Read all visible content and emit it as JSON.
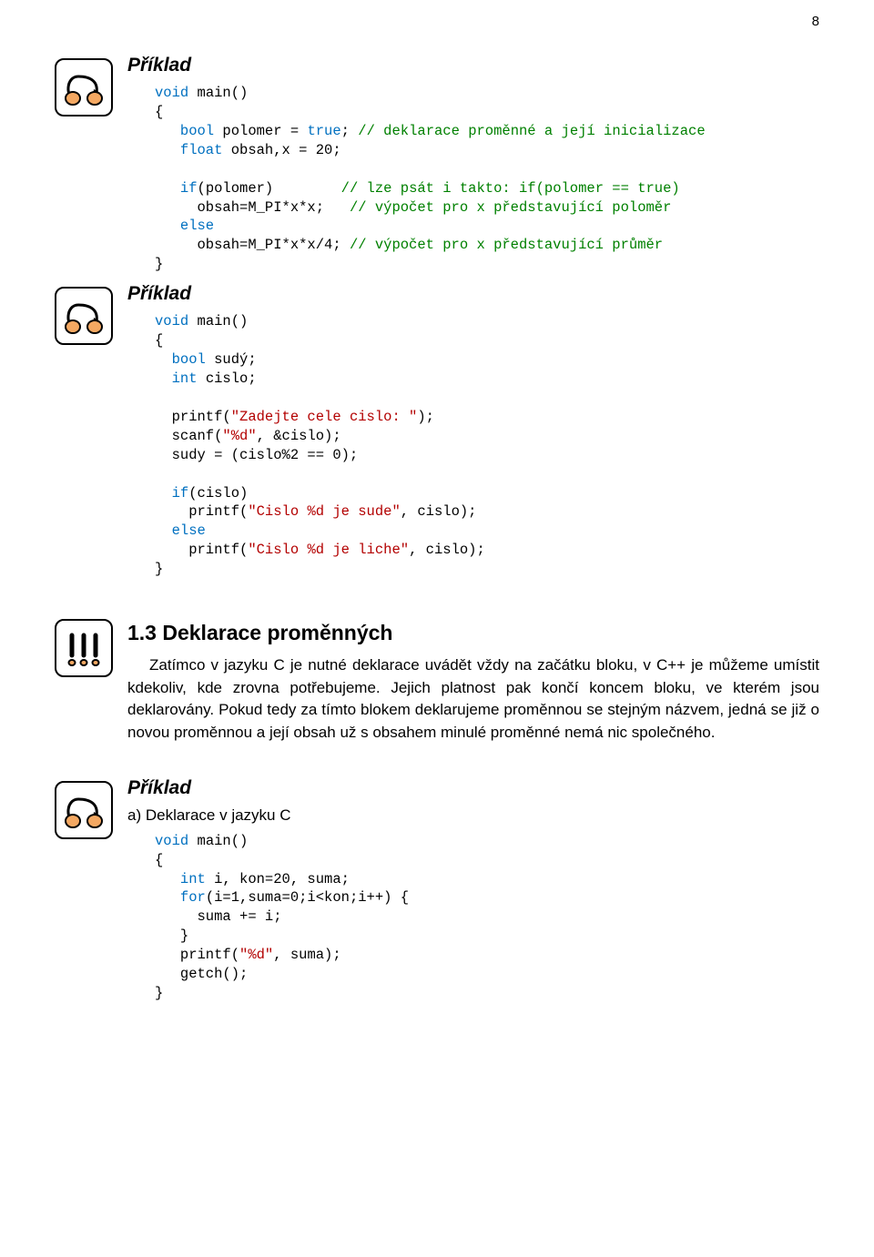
{
  "page_number": "8",
  "example1": {
    "heading": "Příklad",
    "code_lines": [
      [
        {
          "t": "void",
          "c": "kw-type"
        },
        {
          "t": " main()",
          "c": "norm"
        }
      ],
      [
        {
          "t": "{",
          "c": "norm"
        }
      ],
      [
        {
          "t": "   ",
          "c": "norm"
        },
        {
          "t": "bool",
          "c": "kw-type"
        },
        {
          "t": " polomer = ",
          "c": "norm"
        },
        {
          "t": "true",
          "c": "kw-lit"
        },
        {
          "t": "; ",
          "c": "norm"
        },
        {
          "t": "// deklarace proměnné a její inicializace",
          "c": "cmt"
        }
      ],
      [
        {
          "t": "   ",
          "c": "norm"
        },
        {
          "t": "float",
          "c": "kw-type"
        },
        {
          "t": " obsah,x = 20;",
          "c": "norm"
        }
      ],
      [],
      [
        {
          "t": "   ",
          "c": "norm"
        },
        {
          "t": "if",
          "c": "kw-ctrl"
        },
        {
          "t": "(polomer)        ",
          "c": "norm"
        },
        {
          "t": "// lze psát i takto: if(polomer == true)",
          "c": "cmt"
        }
      ],
      [
        {
          "t": "     obsah=M_PI*x*x;   ",
          "c": "norm"
        },
        {
          "t": "// výpočet pro x představující poloměr",
          "c": "cmt"
        }
      ],
      [
        {
          "t": "   ",
          "c": "norm"
        },
        {
          "t": "else",
          "c": "kw-ctrl"
        }
      ],
      [
        {
          "t": "     obsah=M_PI*x*x/4; ",
          "c": "norm"
        },
        {
          "t": "// výpočet pro x představující průměr",
          "c": "cmt"
        }
      ],
      [
        {
          "t": "}",
          "c": "norm"
        }
      ]
    ]
  },
  "example2": {
    "heading": "Příklad",
    "code_lines": [
      [
        {
          "t": "void",
          "c": "kw-type"
        },
        {
          "t": " main()",
          "c": "norm"
        }
      ],
      [
        {
          "t": "{",
          "c": "norm"
        }
      ],
      [
        {
          "t": "  ",
          "c": "norm"
        },
        {
          "t": "bool",
          "c": "kw-type"
        },
        {
          "t": " sudý;",
          "c": "norm"
        }
      ],
      [
        {
          "t": "  ",
          "c": "norm"
        },
        {
          "t": "int",
          "c": "kw-type"
        },
        {
          "t": " cislo;",
          "c": "norm"
        }
      ],
      [],
      [
        {
          "t": "  printf(",
          "c": "norm"
        },
        {
          "t": "\"Zadejte cele cislo: \"",
          "c": "str"
        },
        {
          "t": ");",
          "c": "norm"
        }
      ],
      [
        {
          "t": "  scanf(",
          "c": "norm"
        },
        {
          "t": "\"%d\"",
          "c": "str"
        },
        {
          "t": ", &cislo);",
          "c": "norm"
        }
      ],
      [
        {
          "t": "  sudy = (cislo%2 == 0);",
          "c": "norm"
        }
      ],
      [],
      [
        {
          "t": "  ",
          "c": "norm"
        },
        {
          "t": "if",
          "c": "kw-ctrl"
        },
        {
          "t": "(cislo)",
          "c": "norm"
        }
      ],
      [
        {
          "t": "    printf(",
          "c": "norm"
        },
        {
          "t": "\"Cislo %d je sude\"",
          "c": "str"
        },
        {
          "t": ", cislo);",
          "c": "norm"
        }
      ],
      [
        {
          "t": "  ",
          "c": "norm"
        },
        {
          "t": "else",
          "c": "kw-ctrl"
        }
      ],
      [
        {
          "t": "    printf(",
          "c": "norm"
        },
        {
          "t": "\"Cislo %d je liche\"",
          "c": "str"
        },
        {
          "t": ", cislo);",
          "c": "norm"
        }
      ],
      [
        {
          "t": "}",
          "c": "norm"
        }
      ]
    ]
  },
  "section13": {
    "heading": "1.3  Deklarace proměnných",
    "body": "Zatímco v jazyku C je nutné deklarace uvádět vždy na začátku bloku, v C++ je můžeme umístit kdekoliv, kde zrovna potřebujeme. Jejich platnost pak končí koncem bloku, ve kterém jsou deklarovány. Pokud tedy za tímto blokem deklarujeme proměnnou se stejným názvem, jedná se již o novou proměnnou a její obsah už s obsahem minulé proměnné nemá nic společného."
  },
  "example3": {
    "heading": "Příklad",
    "subtitle": "a) Deklarace v jazyku C",
    "code_lines": [
      [
        {
          "t": "void",
          "c": "kw-type"
        },
        {
          "t": " main()",
          "c": "norm"
        }
      ],
      [
        {
          "t": "{",
          "c": "norm"
        }
      ],
      [
        {
          "t": "   ",
          "c": "norm"
        },
        {
          "t": "int",
          "c": "kw-type"
        },
        {
          "t": " i, kon=20, suma;",
          "c": "norm"
        }
      ],
      [
        {
          "t": "   ",
          "c": "norm"
        },
        {
          "t": "for",
          "c": "kw-ctrl"
        },
        {
          "t": "(i=1,suma=0;i<kon;i++) {",
          "c": "norm"
        }
      ],
      [
        {
          "t": "     suma += i;",
          "c": "norm"
        }
      ],
      [
        {
          "t": "   }",
          "c": "norm"
        }
      ],
      [
        {
          "t": "   printf(",
          "c": "norm"
        },
        {
          "t": "\"%d\"",
          "c": "str"
        },
        {
          "t": ", suma);",
          "c": "norm"
        }
      ],
      [
        {
          "t": "   getch();",
          "c": "norm"
        }
      ],
      [
        {
          "t": "}",
          "c": "norm"
        }
      ]
    ]
  }
}
